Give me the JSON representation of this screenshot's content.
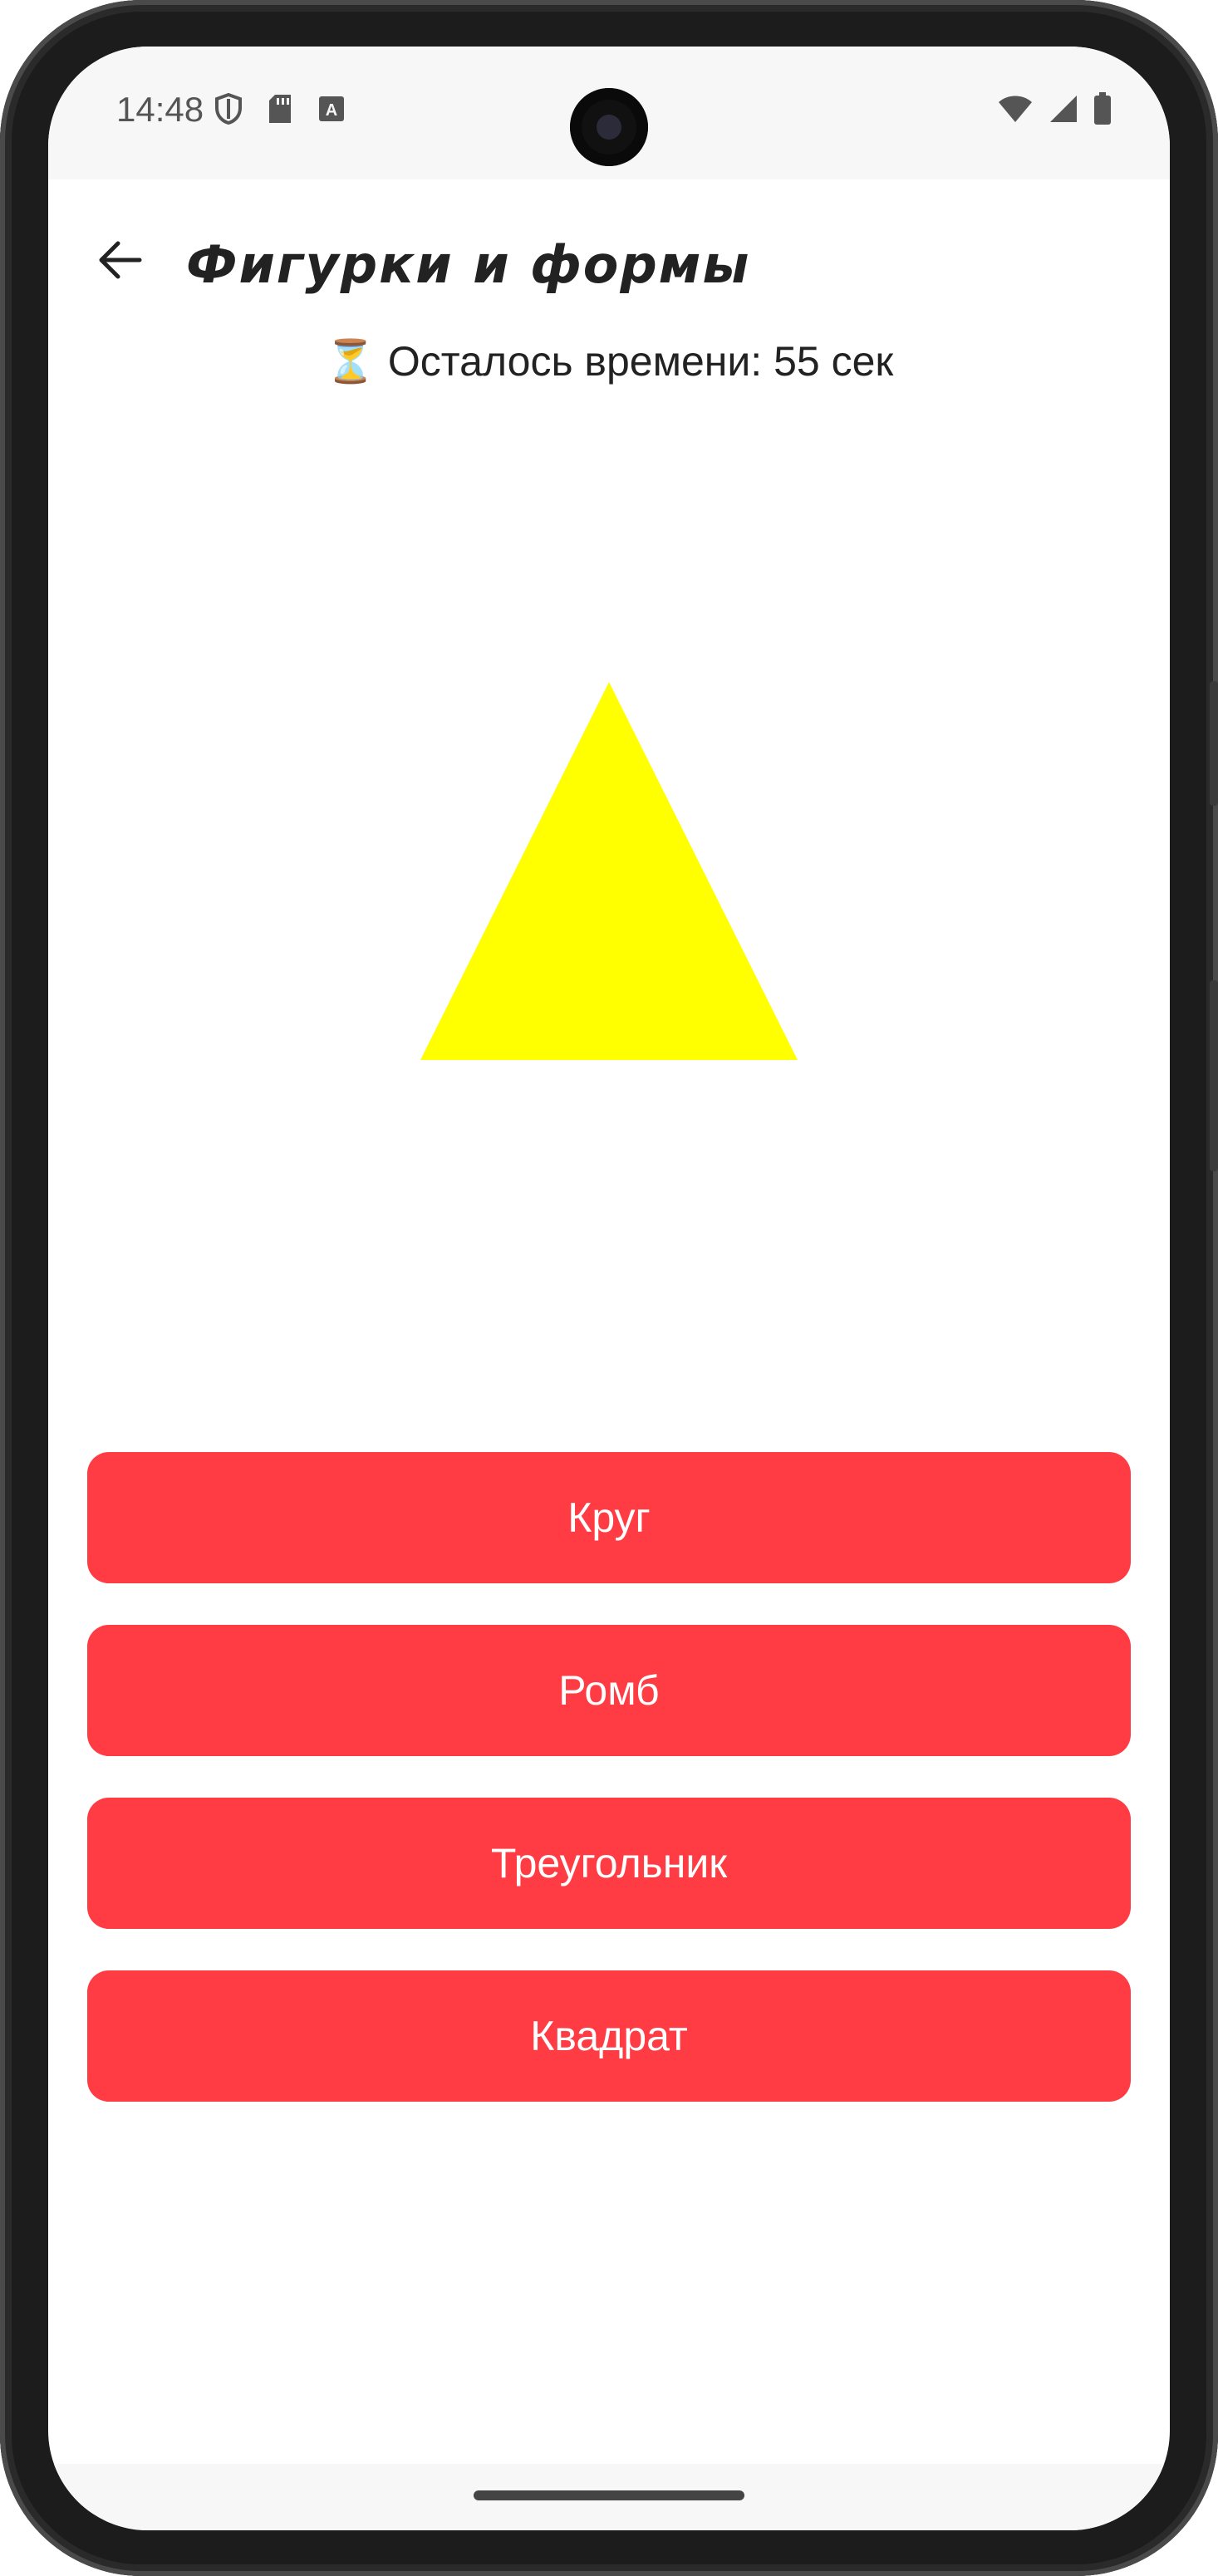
{
  "status_bar": {
    "time": "14:48",
    "left_icons": [
      "shield-icon",
      "sd-card-icon",
      "keyboard-a-icon"
    ],
    "right_icons": [
      "wifi-icon",
      "signal-icon",
      "battery-icon"
    ]
  },
  "app_bar": {
    "title": "Фигурки и формы",
    "back_icon": "arrow-back-icon"
  },
  "timer": {
    "icon": "⏳",
    "text": "Осталось времени: 55 сек"
  },
  "shape": {
    "type": "triangle",
    "color": "#ffff00"
  },
  "answers": [
    {
      "label": "Круг"
    },
    {
      "label": "Ромб"
    },
    {
      "label": "Треугольник"
    },
    {
      "label": "Квадрат"
    }
  ],
  "colors": {
    "button": "#ff3c43",
    "button_text": "#ffffff"
  }
}
